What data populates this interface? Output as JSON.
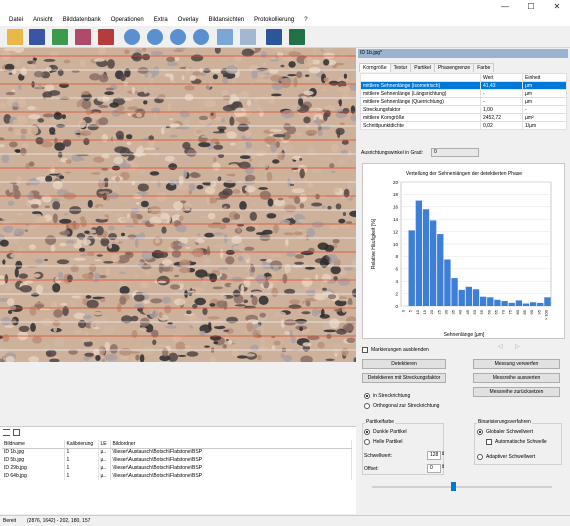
{
  "window": {
    "minimize": "—",
    "maximize": "☐",
    "close": "✕"
  },
  "menu": [
    "Datei",
    "Ansicht",
    "Bilddatenbank",
    "Operationen",
    "Extra",
    "Overlay",
    "Bildansichten",
    "Protokollierung",
    "?"
  ],
  "toolbar_icons": [
    "open-folder-icon",
    "save-icon",
    "image-import-icon",
    "image-grid-icon",
    "export-icon",
    "zoom-in-icon",
    "zoom-out-icon",
    "zoom-fit-icon",
    "zoom-100-icon",
    "image-view-icon",
    "image-compare-icon",
    "word-export-icon",
    "excel-export-icon"
  ],
  "right": {
    "header": "ID 1b.jpg*",
    "tabs": [
      "Korngröße",
      "Textur",
      "Partikel",
      "Phasengrenze",
      "Farbe"
    ],
    "table_headers": [
      "Wert",
      "Einheit"
    ],
    "rows": [
      {
        "name": "mittlere Sehnenlänge (isometrisch)",
        "value": "41,43",
        "unit": "µm"
      },
      {
        "name": "mittlere Sehnenlänge (Längsrichtung)",
        "value": "-",
        "unit": "µm"
      },
      {
        "name": "mittlere Sehnenlänge (Querrichtung)",
        "value": "-",
        "unit": "µm"
      },
      {
        "name": "Streckungsfaktor",
        "value": "1,00",
        "unit": "-"
      },
      {
        "name": "mittlere Korngröße",
        "value": "2452,72",
        "unit": "µm²"
      },
      {
        "name": "Schnittpunktdichte",
        "value": "0,02",
        "unit": "1/µm"
      }
    ],
    "angle_label": "Ausrichtungswinkel in Grad:",
    "angle_value": "0",
    "markings_label": "Markierungen ausblenden",
    "btn_detect": "Detektieren",
    "btn_discard": "Messung verwerfen",
    "btn_detect_stretch": "Detektieren mit Streckungsfaktor",
    "btn_evaluate": "Messreihe auswerten",
    "btn_reset": "Messreihe zurücksetzen",
    "radio_stretch": "in Streckrichtung",
    "radio_ortho": "Orthogonal zur Streckrichtung",
    "particle_group": "Partikelfarbe",
    "dark": "Dunkle Partikel",
    "light": "Helle Partikel",
    "threshold_label": "Schwellwert:",
    "threshold_value": "128",
    "offset_label": "Offset:",
    "offset_value": "0",
    "bin_group": "Binarisierungsverfahren",
    "global": "Globaler Schwellwert",
    "auto": "Automatische Schwelle",
    "adaptive": "Adaptiver Schwellwert",
    "slider_value": 0.45
  },
  "lower_table": {
    "headers": [
      "Bildname",
      "Kalibrierung",
      "LE",
      "Bildordner"
    ],
    "rows": [
      [
        "ID 1b.jpg",
        "1",
        "µ..",
        "\\\\lieser\\Austausch\\Botsch\\Flatstone\\BSP"
      ],
      [
        "ID 5b.jpg",
        "1",
        "µ..",
        "\\\\lieser\\Austausch\\Botsch\\Flatstone\\BSP"
      ],
      [
        "ID 29b.jpg",
        "1",
        "µ..",
        "\\\\lieser\\Austausch\\Botsch\\Flatstone\\BSP"
      ],
      [
        "ID 64b.jpg",
        "1",
        "µ..",
        "\\\\lieser\\Austausch\\Botsch\\Flatstone\\BSP"
      ]
    ]
  },
  "status": {
    "ready": "Bereit",
    "coords": "(2876, 1642) - 202, 180, 157"
  },
  "chart_data": {
    "type": "bar",
    "title": "Verteilung der Sehnenlängen der detektierten Phase",
    "xlabel": "Sehnenlänge [µm]",
    "ylabel": "Relative Häufigkeit [%]",
    "ylim": [
      0,
      20
    ],
    "yticks": [
      "0",
      "2",
      "4",
      "6",
      "8",
      "10",
      "12",
      "14",
      "16",
      "18",
      "20"
    ],
    "categories": [
      "0",
      "5",
      "10",
      "15",
      "20",
      "25",
      "30",
      "35",
      "40",
      "45",
      "50",
      "55",
      "60",
      "65",
      "70",
      "75",
      "80",
      "85",
      "90",
      "95",
      "> 100"
    ],
    "values": [
      0,
      12.2,
      17,
      15.6,
      13.8,
      11.6,
      7.5,
      4.5,
      2.6,
      3.1,
      2.7,
      1.5,
      1.4,
      1.0,
      0.8,
      0.5,
      0.9,
      0.4,
      0.6,
      0.5,
      1.4
    ]
  }
}
